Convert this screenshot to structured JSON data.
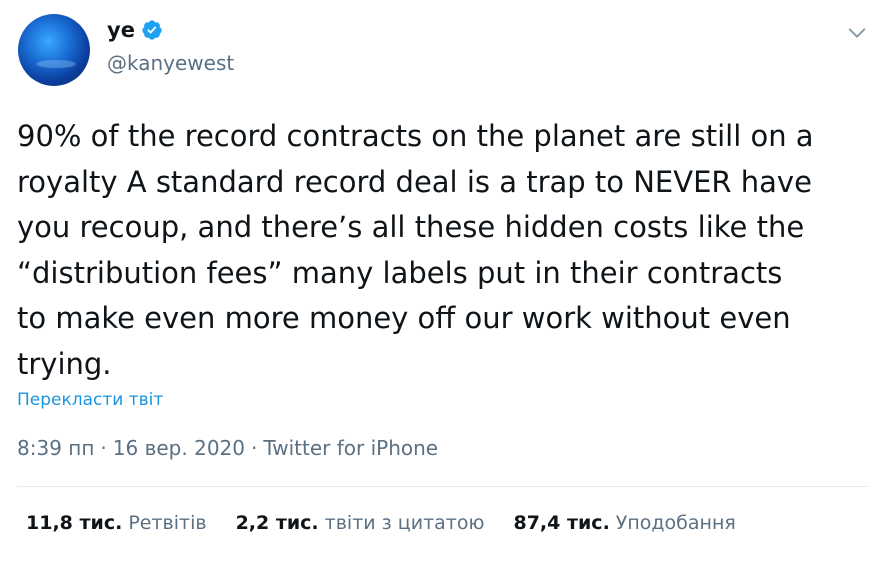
{
  "author": {
    "display_name": "ye",
    "handle": "@kanyewest",
    "verified_icon": "verified-badge-icon",
    "avatar": "avatar-image"
  },
  "colors": {
    "text": "#0f1419",
    "secondary": "#5b7083",
    "link": "#1b95e0",
    "verified": "#1da1f2",
    "divider": "#e6ecf0"
  },
  "tweet": {
    "lines": [
      "90% of the record contracts on the planet are still on a",
      "royalty A standard record deal is a trap to NEVER have",
      "you recoup, and there’s all these hidden costs like the",
      "“distribution fees” many labels put in their contracts",
      "to make even more money off our work without even",
      "trying."
    ],
    "translate_label": "Перекласти твіт"
  },
  "meta": {
    "time": "8:39 пп",
    "sep1": "·",
    "date": "16 вер. 2020",
    "sep2": "·",
    "source": "Twitter for iPhone"
  },
  "stats": [
    {
      "count": "11,8 тис.",
      "label": "Ретвітів"
    },
    {
      "count": "2,2 тис.",
      "label": "твіти з цитатою"
    },
    {
      "count": "87,4 тис.",
      "label": "Уподобання"
    }
  ],
  "menu_icon": "chevron-down-icon"
}
